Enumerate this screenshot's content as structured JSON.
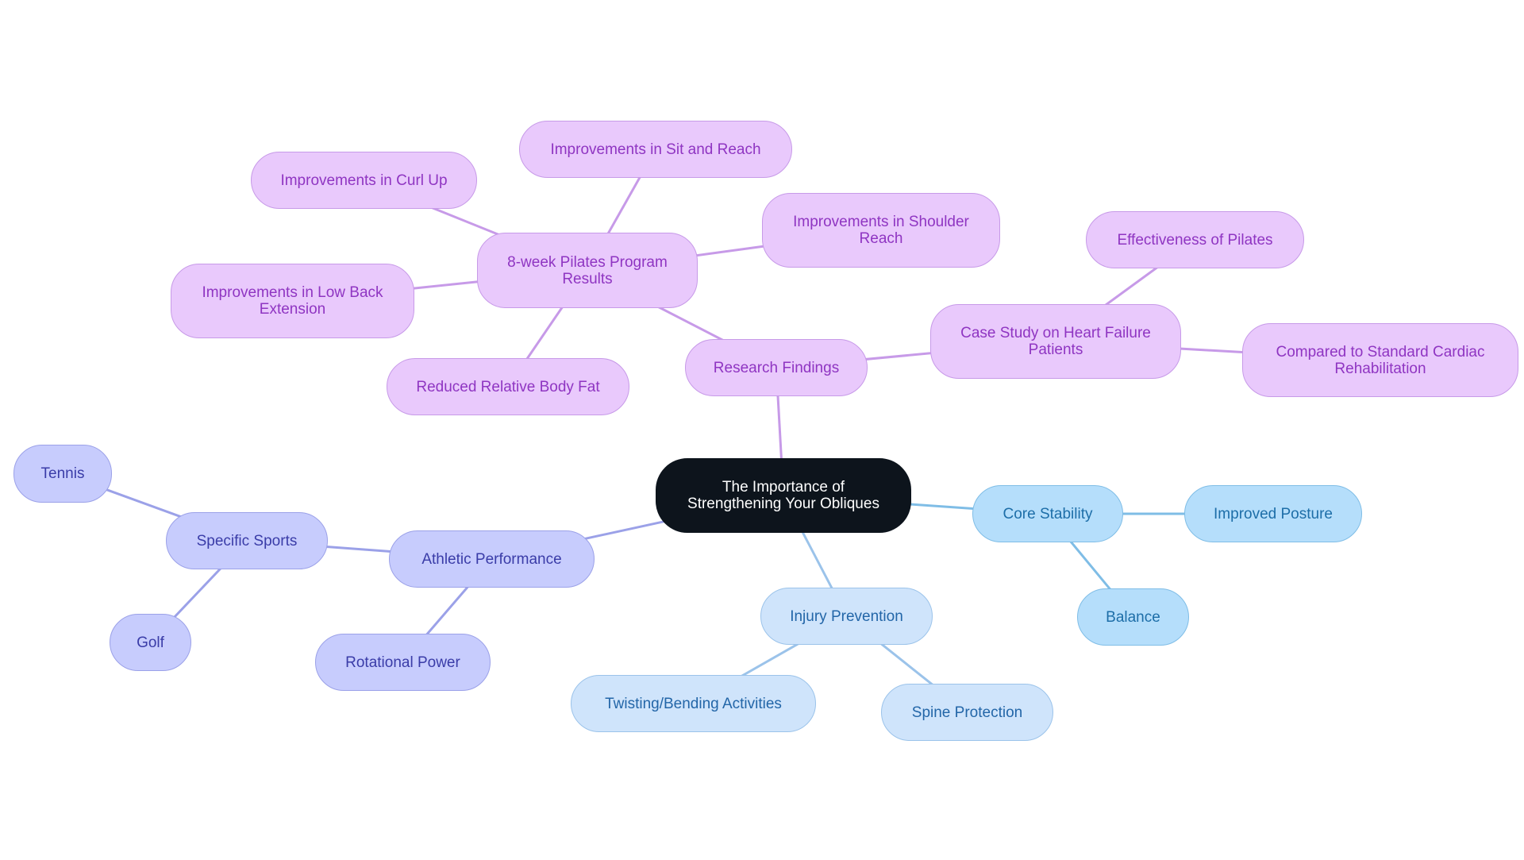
{
  "diagram": {
    "type": "mindmap",
    "root": {
      "id": "root",
      "label": "The Importance of Strengthening Your Obliques"
    },
    "nodes": [
      {
        "id": "research",
        "label": "Research Findings",
        "parent": "root",
        "branch": "purple"
      },
      {
        "id": "pilates8",
        "label": "8-week Pilates Program Results",
        "parent": "research",
        "branch": "purple"
      },
      {
        "id": "curlup",
        "label": "Improvements in Curl Up",
        "parent": "pilates8",
        "branch": "purple"
      },
      {
        "id": "sitreach",
        "label": "Improvements in Sit and Reach",
        "parent": "pilates8",
        "branch": "purple"
      },
      {
        "id": "shoulder",
        "label": "Improvements in Shoulder Reach",
        "parent": "pilates8",
        "branch": "purple"
      },
      {
        "id": "lowback",
        "label": "Improvements in Low Back Extension",
        "parent": "pilates8",
        "branch": "purple"
      },
      {
        "id": "bodyfat",
        "label": "Reduced Relative Body Fat",
        "parent": "pilates8",
        "branch": "purple"
      },
      {
        "id": "casestudy",
        "label": "Case Study on Heart Failure Patients",
        "parent": "research",
        "branch": "purple"
      },
      {
        "id": "effectiveness",
        "label": "Effectiveness of Pilates",
        "parent": "casestudy",
        "branch": "purple"
      },
      {
        "id": "compared",
        "label": "Compared to Standard Cardiac Rehabilitation",
        "parent": "casestudy",
        "branch": "purple"
      },
      {
        "id": "core",
        "label": "Core Stability",
        "parent": "root",
        "branch": "blue"
      },
      {
        "id": "posture",
        "label": "Improved Posture",
        "parent": "core",
        "branch": "blue"
      },
      {
        "id": "balance",
        "label": "Balance",
        "parent": "core",
        "branch": "blue"
      },
      {
        "id": "injury",
        "label": "Injury Prevention",
        "parent": "root",
        "branch": "lightblue"
      },
      {
        "id": "twisting",
        "label": "Twisting/Bending Activities",
        "parent": "injury",
        "branch": "lightblue"
      },
      {
        "id": "spine",
        "label": "Spine Protection",
        "parent": "injury",
        "branch": "lightblue"
      },
      {
        "id": "athletic",
        "label": "Athletic Performance",
        "parent": "root",
        "branch": "indigo"
      },
      {
        "id": "sports",
        "label": "Specific Sports",
        "parent": "athletic",
        "branch": "indigo"
      },
      {
        "id": "tennis",
        "label": "Tennis",
        "parent": "sports",
        "branch": "indigo"
      },
      {
        "id": "golf",
        "label": "Golf",
        "parent": "sports",
        "branch": "indigo"
      },
      {
        "id": "rotational",
        "label": "Rotational Power",
        "parent": "athletic",
        "branch": "indigo"
      }
    ],
    "branch_colors": {
      "purple": {
        "fill": "#e9c9fc",
        "stroke": "#c79ae8",
        "text": "#8f35c2",
        "edge": "#c79ae8"
      },
      "blue": {
        "fill": "#b5defb",
        "stroke": "#7fbde6",
        "text": "#1d6ea8",
        "edge": "#7fbde6"
      },
      "lightblue": {
        "fill": "#cfe4fb",
        "stroke": "#9bc3ea",
        "text": "#2366a8",
        "edge": "#9bc3ea"
      },
      "indigo": {
        "fill": "#c7ccfd",
        "stroke": "#9ba1e8",
        "text": "#3a3ca8",
        "edge": "#9ba1e8"
      },
      "root": {
        "fill": "#0d141c",
        "text": "#ffffff"
      }
    }
  }
}
